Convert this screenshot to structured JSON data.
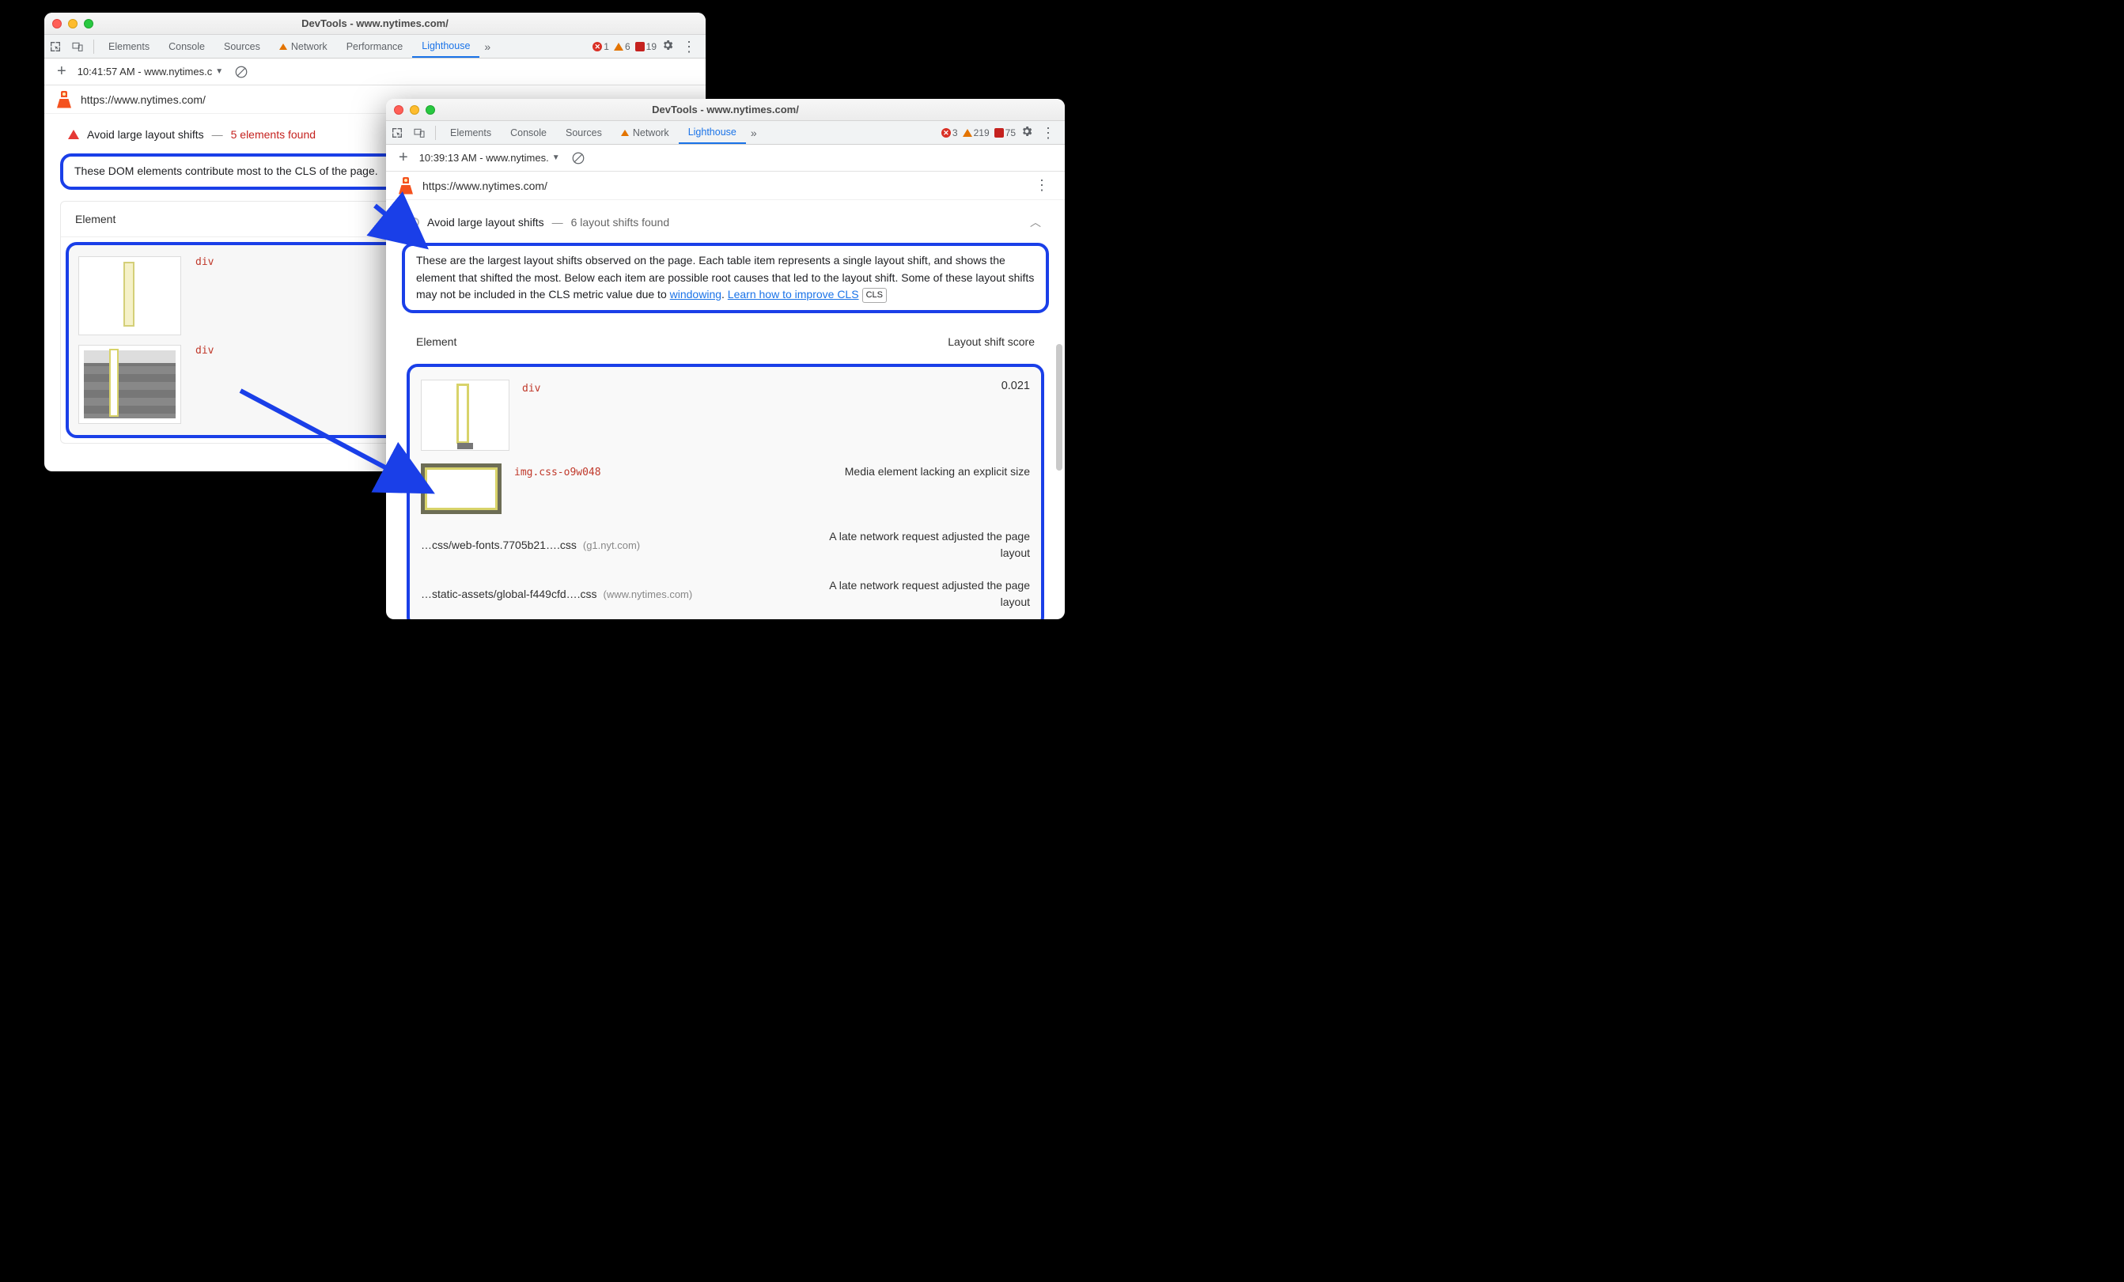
{
  "windowLeft": {
    "title": "DevTools - www.nytimes.com/",
    "tabs": [
      "Elements",
      "Console",
      "Sources",
      "Network",
      "Performance",
      "Lighthouse"
    ],
    "activeTab": "Lighthouse",
    "errors": {
      "err": "1",
      "warn": "6",
      "info": "19"
    },
    "dropdown": "10:41:57 AM - www.nytimes.c",
    "url": "https://www.nytimes.com/",
    "audit": {
      "title": "Avoid large layout shifts",
      "detail": "5 elements found"
    },
    "desc": "These DOM elements contribute most to the CLS of the page.",
    "colElement": "Element",
    "rows": [
      {
        "label": "div"
      },
      {
        "label": "div"
      }
    ]
  },
  "windowRight": {
    "title": "DevTools - www.nytimes.com/",
    "tabs": [
      "Elements",
      "Console",
      "Sources",
      "Network",
      "Lighthouse"
    ],
    "activeTab": "Lighthouse",
    "errors": {
      "err": "3",
      "warn": "219",
      "info": "75"
    },
    "dropdown": "10:39:13 AM - www.nytimes.",
    "url": "https://www.nytimes.com/",
    "audit": {
      "title": "Avoid large layout shifts",
      "detail": "6 layout shifts found"
    },
    "descParts": {
      "p1": "These are the largest layout shifts observed on the page. Each table item represents a single layout shift, and shows the element that shifted the most. Below each item are possible root causes that led to the layout shift. Some of these layout shifts may not be included in the CLS metric value due to ",
      "link1": "windowing",
      "mid": ". ",
      "link2": "Learn how to improve CLS",
      "chip": "CLS"
    },
    "colElement": "Element",
    "colScore": "Layout shift score",
    "rows": {
      "r1": {
        "label": "div",
        "score": "0.021"
      },
      "r2": {
        "label": "img.css-o9w048",
        "reason": "Media element lacking an explicit size"
      },
      "r3": {
        "file": "…css/web-fonts.7705b21….css",
        "host": "(g1.nyt.com)",
        "reason": "A late network request adjusted the page layout"
      },
      "r4": {
        "file": "…static-assets/global-f449cfd….css",
        "host": "(www.nytimes.com)",
        "reason": "A late network request adjusted the page layout"
      }
    }
  }
}
